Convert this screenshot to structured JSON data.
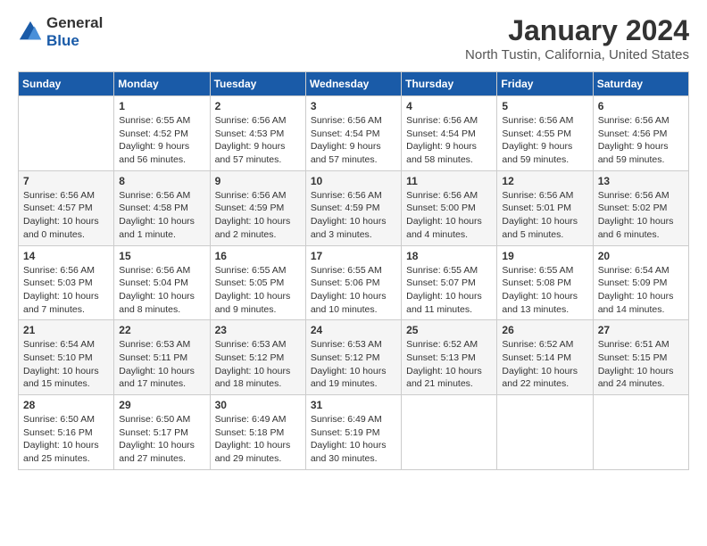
{
  "logo": {
    "general": "General",
    "blue": "Blue"
  },
  "header": {
    "title": "January 2024",
    "subtitle": "North Tustin, California, United States"
  },
  "calendar": {
    "days_of_week": [
      "Sunday",
      "Monday",
      "Tuesday",
      "Wednesday",
      "Thursday",
      "Friday",
      "Saturday"
    ],
    "weeks": [
      [
        {
          "day": "",
          "info": ""
        },
        {
          "day": "1",
          "info": "Sunrise: 6:55 AM\nSunset: 4:52 PM\nDaylight: 9 hours\nand 56 minutes."
        },
        {
          "day": "2",
          "info": "Sunrise: 6:56 AM\nSunset: 4:53 PM\nDaylight: 9 hours\nand 57 minutes."
        },
        {
          "day": "3",
          "info": "Sunrise: 6:56 AM\nSunset: 4:54 PM\nDaylight: 9 hours\nand 57 minutes."
        },
        {
          "day": "4",
          "info": "Sunrise: 6:56 AM\nSunset: 4:54 PM\nDaylight: 9 hours\nand 58 minutes."
        },
        {
          "day": "5",
          "info": "Sunrise: 6:56 AM\nSunset: 4:55 PM\nDaylight: 9 hours\nand 59 minutes."
        },
        {
          "day": "6",
          "info": "Sunrise: 6:56 AM\nSunset: 4:56 PM\nDaylight: 9 hours\nand 59 minutes."
        }
      ],
      [
        {
          "day": "7",
          "info": "Sunrise: 6:56 AM\nSunset: 4:57 PM\nDaylight: 10 hours\nand 0 minutes."
        },
        {
          "day": "8",
          "info": "Sunrise: 6:56 AM\nSunset: 4:58 PM\nDaylight: 10 hours\nand 1 minute."
        },
        {
          "day": "9",
          "info": "Sunrise: 6:56 AM\nSunset: 4:59 PM\nDaylight: 10 hours\nand 2 minutes."
        },
        {
          "day": "10",
          "info": "Sunrise: 6:56 AM\nSunset: 4:59 PM\nDaylight: 10 hours\nand 3 minutes."
        },
        {
          "day": "11",
          "info": "Sunrise: 6:56 AM\nSunset: 5:00 PM\nDaylight: 10 hours\nand 4 minutes."
        },
        {
          "day": "12",
          "info": "Sunrise: 6:56 AM\nSunset: 5:01 PM\nDaylight: 10 hours\nand 5 minutes."
        },
        {
          "day": "13",
          "info": "Sunrise: 6:56 AM\nSunset: 5:02 PM\nDaylight: 10 hours\nand 6 minutes."
        }
      ],
      [
        {
          "day": "14",
          "info": "Sunrise: 6:56 AM\nSunset: 5:03 PM\nDaylight: 10 hours\nand 7 minutes."
        },
        {
          "day": "15",
          "info": "Sunrise: 6:56 AM\nSunset: 5:04 PM\nDaylight: 10 hours\nand 8 minutes."
        },
        {
          "day": "16",
          "info": "Sunrise: 6:55 AM\nSunset: 5:05 PM\nDaylight: 10 hours\nand 9 minutes."
        },
        {
          "day": "17",
          "info": "Sunrise: 6:55 AM\nSunset: 5:06 PM\nDaylight: 10 hours\nand 10 minutes."
        },
        {
          "day": "18",
          "info": "Sunrise: 6:55 AM\nSunset: 5:07 PM\nDaylight: 10 hours\nand 11 minutes."
        },
        {
          "day": "19",
          "info": "Sunrise: 6:55 AM\nSunset: 5:08 PM\nDaylight: 10 hours\nand 13 minutes."
        },
        {
          "day": "20",
          "info": "Sunrise: 6:54 AM\nSunset: 5:09 PM\nDaylight: 10 hours\nand 14 minutes."
        }
      ],
      [
        {
          "day": "21",
          "info": "Sunrise: 6:54 AM\nSunset: 5:10 PM\nDaylight: 10 hours\nand 15 minutes."
        },
        {
          "day": "22",
          "info": "Sunrise: 6:53 AM\nSunset: 5:11 PM\nDaylight: 10 hours\nand 17 minutes."
        },
        {
          "day": "23",
          "info": "Sunrise: 6:53 AM\nSunset: 5:12 PM\nDaylight: 10 hours\nand 18 minutes."
        },
        {
          "day": "24",
          "info": "Sunrise: 6:53 AM\nSunset: 5:12 PM\nDaylight: 10 hours\nand 19 minutes."
        },
        {
          "day": "25",
          "info": "Sunrise: 6:52 AM\nSunset: 5:13 PM\nDaylight: 10 hours\nand 21 minutes."
        },
        {
          "day": "26",
          "info": "Sunrise: 6:52 AM\nSunset: 5:14 PM\nDaylight: 10 hours\nand 22 minutes."
        },
        {
          "day": "27",
          "info": "Sunrise: 6:51 AM\nSunset: 5:15 PM\nDaylight: 10 hours\nand 24 minutes."
        }
      ],
      [
        {
          "day": "28",
          "info": "Sunrise: 6:50 AM\nSunset: 5:16 PM\nDaylight: 10 hours\nand 25 minutes."
        },
        {
          "day": "29",
          "info": "Sunrise: 6:50 AM\nSunset: 5:17 PM\nDaylight: 10 hours\nand 27 minutes."
        },
        {
          "day": "30",
          "info": "Sunrise: 6:49 AM\nSunset: 5:18 PM\nDaylight: 10 hours\nand 29 minutes."
        },
        {
          "day": "31",
          "info": "Sunrise: 6:49 AM\nSunset: 5:19 PM\nDaylight: 10 hours\nand 30 minutes."
        },
        {
          "day": "",
          "info": ""
        },
        {
          "day": "",
          "info": ""
        },
        {
          "day": "",
          "info": ""
        }
      ]
    ]
  }
}
